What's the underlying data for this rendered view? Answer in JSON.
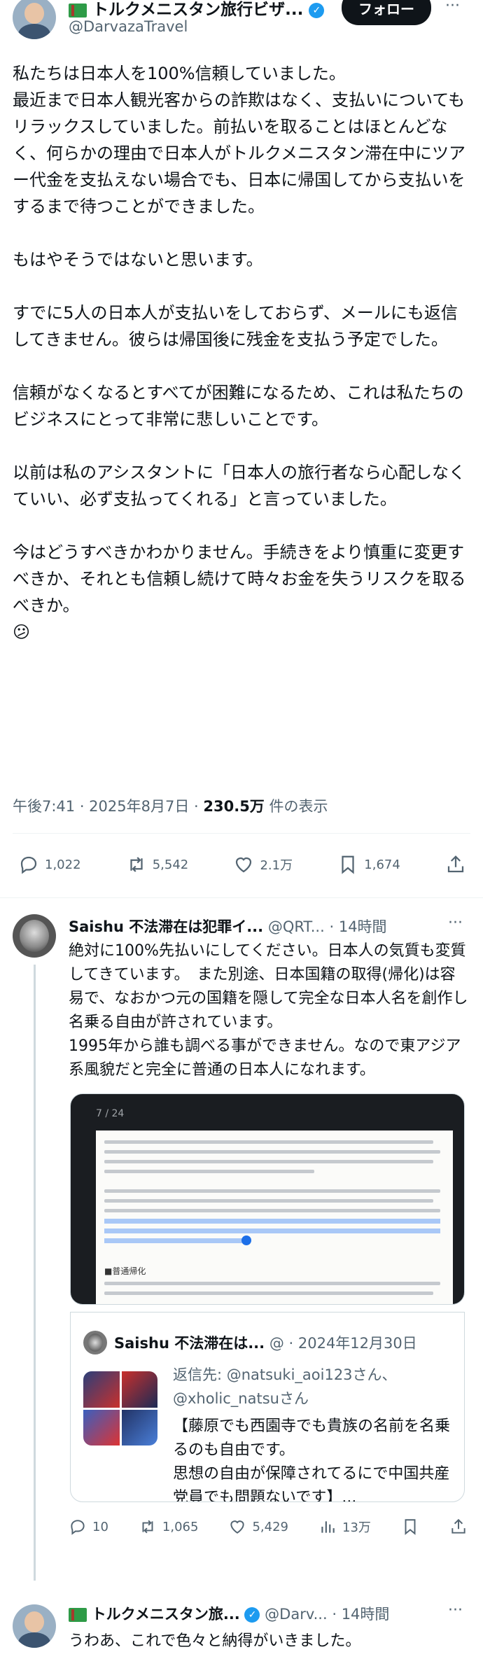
{
  "tweet": {
    "display_name": "トルクメニスタン旅行ビザ...",
    "handle": "@DarvazaTravel",
    "follow_label": "フォロー",
    "more": "···",
    "paragraphs": [
      "私たちは日本人を100%信頼していました。\n最近まで日本人観光客からの詐欺はなく、支払いについてもリラックスしていました。前払いを取ることはほとんどなく、何らかの理由で日本人がトルクメニスタン滞在中にツアー代金を支払えない場合でも、日本に帰国してから支払いをするまで待つことができました。",
      "もはやそうではないと思います。",
      "すでに5人の日本人が支払いをしておらず、メールにも返信してきません。彼らは帰国後に残金を支払う予定でした。",
      "信頼がなくなるとすべてが困難になるため、これは私たちのビジネスにとって非常に悲しいことです。",
      "以前は私のアシスタントに「日本人の旅行者なら心配しなくていい、必ず支払ってくれる」と言っていました。",
      "今はどうすべきかわかりません。手続きをより慎重に変更すべきか、それとも信頼し続けて時々お金を失うリスクを取るべきか。"
    ],
    "emoji": "😕",
    "time": "午後7:41 · 2025年8月7日 · ",
    "views_count": "230.5万",
    "views_label": " 件の表示",
    "stats": {
      "replies": "1,022",
      "retweets": "5,542",
      "likes": "2.1万",
      "bookmarks": "1,674"
    }
  },
  "reply": {
    "display_name": "Saishu 不法滞在は犯罪イ...",
    "handle": "@QRT...",
    "time": "· 14時間",
    "more": "···",
    "text": "絶対に100%先払いにしてください。日本人の気質も変質してきています。　また別途、日本国籍の取得(帰化)は容易で、なおかつ元の国籍を隠して完全な日本人名を創作し名乗る自由が許されています。\n1995年から誰も調べる事ができません。なので東アジア系風貌だと完全に普通の日本人になれます。",
    "doc_page": "7 / 24",
    "doc_heading": "■普通帰化",
    "quote": {
      "display_name": "Saishu 不法滞在は...",
      "handle": "@",
      "date": "· 2024年12月30日",
      "reply_to": "返信先: @natsuki_aoi123さん、\n@xholic_natsuさん",
      "text": "【藤原でも西園寺でも貴族の名前を名乗るのも自由です。\n思想の自由が保障されてるにで中国共産党員でも問題ないです】..."
    },
    "stats": {
      "replies": "10",
      "retweets": "1,065",
      "likes": "5,429",
      "views": "13万"
    }
  },
  "reply2": {
    "display_name": "トルクメニスタン旅...",
    "handle": "@Darv...",
    "time": "· 14時間",
    "more": "···",
    "text": "うわあ、これで色々と納得がいきました。"
  }
}
